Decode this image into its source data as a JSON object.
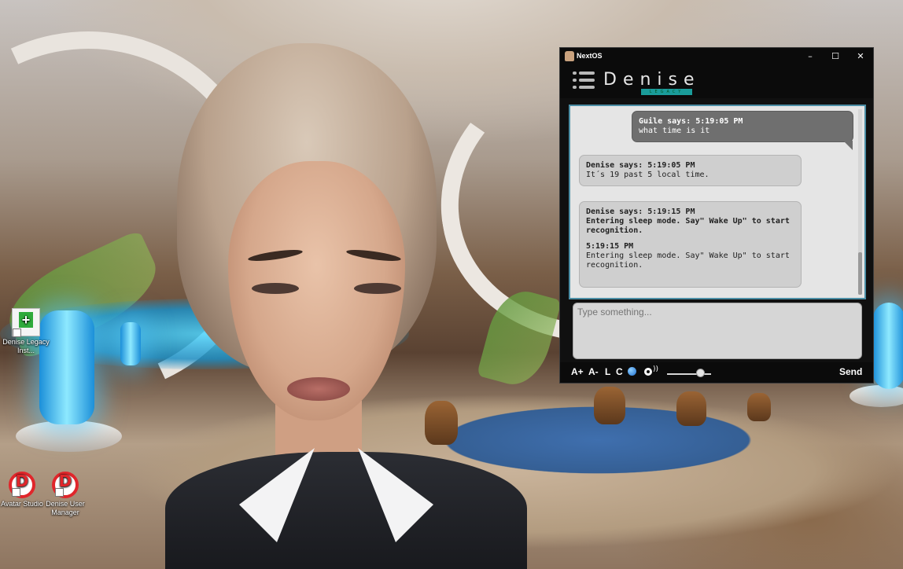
{
  "desktop": {
    "icons": [
      {
        "label": "Denise Legacy Inst...",
        "icon": "installer-icon"
      },
      {
        "label": "Avatar Studio",
        "icon": "denise-d-logo-icon"
      },
      {
        "label": "Denise User Manager",
        "icon": "denise-d-logo-icon"
      }
    ]
  },
  "window": {
    "title": "NextOS",
    "controls": {
      "minimize": "–",
      "maximize": "☐",
      "close": "✕"
    }
  },
  "header": {
    "brand": "Denise",
    "brand_sub": "LEGACY"
  },
  "chat": {
    "messages": [
      {
        "header": "Guile says: 5:19:05 PM",
        "text": "what time is it"
      },
      {
        "header": "Denise says: 5:19:05 PM",
        "text": "It´s 19 past 5 local time."
      },
      {
        "header": "Denise says: 5:19:15 PM",
        "bold_text": "Entering sleep mode. Say\" Wake Up\" to start recognition.",
        "sub_header": "5:19:15 PM",
        "text": "Entering sleep mode. Say\" Wake Up\" to start recognition."
      }
    ]
  },
  "input": {
    "placeholder": "Type something..."
  },
  "toolbar": {
    "font_increase": "A+",
    "font_decrease": "A-",
    "l_button": "L",
    "c_button": "C",
    "send": "Send",
    "volume": 0.75,
    "accent_color": "#1f6fd0"
  }
}
